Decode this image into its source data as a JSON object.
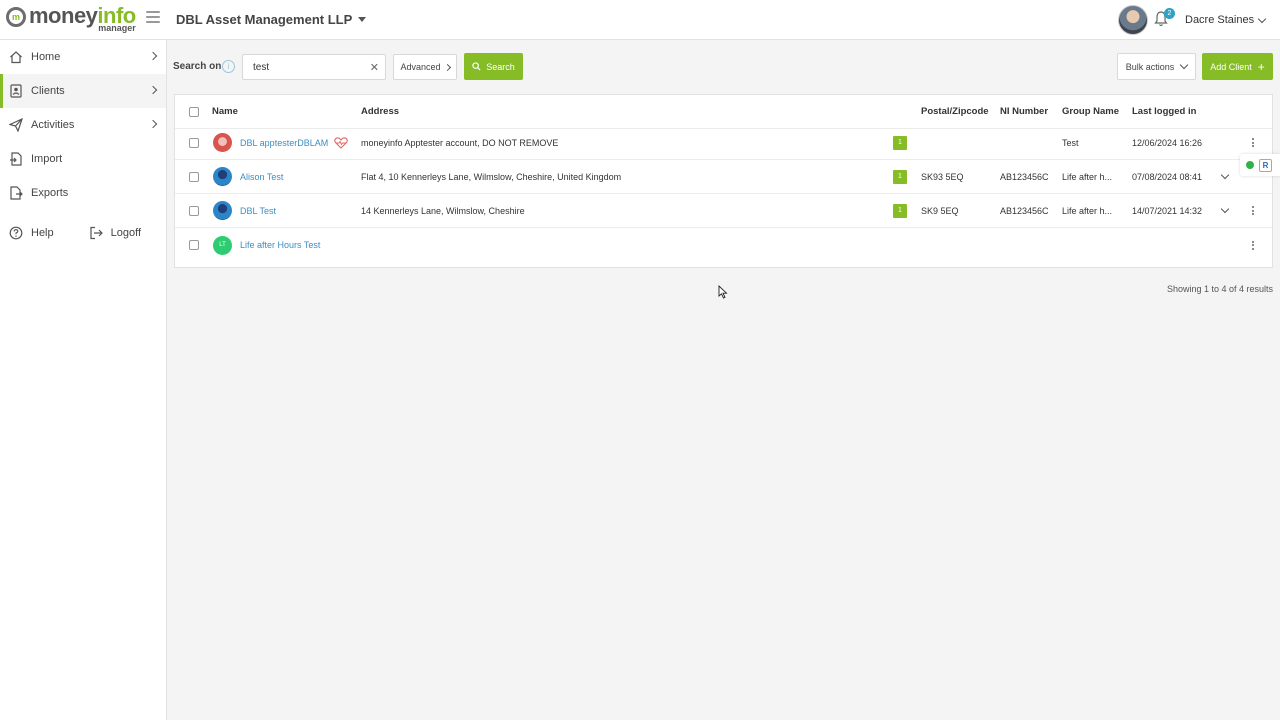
{
  "brand": {
    "logo_main": "money",
    "logo_accent": "info",
    "logo_sub": "manager",
    "badge": "m",
    "accent_color": "#86bc25"
  },
  "header": {
    "org_name": "DBL Asset Management LLP",
    "notification_count": "2",
    "user_name": "Dacre Staines"
  },
  "sidebar": {
    "items": [
      {
        "label": "Home",
        "icon": "home-icon"
      },
      {
        "label": "Clients",
        "icon": "clients-icon"
      },
      {
        "label": "Activities",
        "icon": "paper-plane-icon"
      },
      {
        "label": "Import",
        "icon": "import-icon"
      },
      {
        "label": "Exports",
        "icon": "export-icon"
      }
    ],
    "help_label": "Help",
    "logoff_label": "Logoff"
  },
  "search": {
    "label": "Search on",
    "value": "test",
    "advanced_label": "Advanced",
    "search_button": "Search",
    "bulk_actions_label": "Bulk actions",
    "add_client_label": "Add Client"
  },
  "table": {
    "headers": {
      "name": "Name",
      "address": "Address",
      "postcode": "Postal/Zipcode",
      "ni": "NI Number",
      "group": "Group Name",
      "last_login": "Last logged in"
    },
    "rows": [
      {
        "name": "DBL apptesterDBLAM",
        "address": "moneyinfo Apptester account, DO NOT REMOVE",
        "badge": "1",
        "postcode": "",
        "ni": "",
        "group": "Test",
        "last_login": "12/06/2024 16:26"
      },
      {
        "name": "Alison Test",
        "address": "Flat 4, 10 Kennerleys Lane, Wilmslow, Cheshire, United Kingdom",
        "badge": "1",
        "postcode": "SK93 5EQ",
        "ni": "AB123456C",
        "group": "Life after h...",
        "last_login": "07/08/2024 08:41"
      },
      {
        "name": "DBL Test",
        "address": "14 Kennerleys Lane, Wilmslow, Cheshire",
        "badge": "1",
        "postcode": "SK9 5EQ",
        "ni": "AB123456C",
        "group": "Life after h...",
        "last_login": "14/07/2021 14:32"
      },
      {
        "name": "Life after Hours Test",
        "initials": "LT"
      }
    ]
  },
  "results_text": "Showing 1 to 4 of 4 results",
  "widget_letter": "R"
}
